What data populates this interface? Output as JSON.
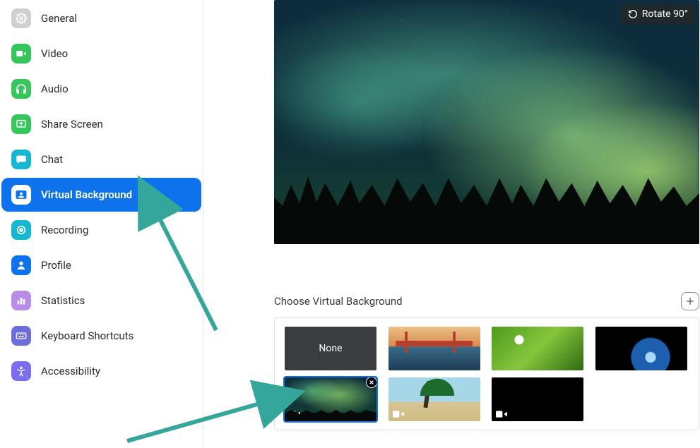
{
  "sidebar": {
    "items": [
      {
        "label": "General",
        "icon": "gear-icon",
        "color": "c-gray"
      },
      {
        "label": "Video",
        "icon": "video-icon",
        "color": "c-green"
      },
      {
        "label": "Audio",
        "icon": "headphones-icon",
        "color": "c-green"
      },
      {
        "label": "Share Screen",
        "icon": "share-screen-icon",
        "color": "c-green"
      },
      {
        "label": "Chat",
        "icon": "chat-icon",
        "color": "c-cyan"
      },
      {
        "label": "Virtual Background",
        "icon": "virtual-background-icon",
        "color": "c-blue",
        "active": true
      },
      {
        "label": "Recording",
        "icon": "recording-icon",
        "color": "c-cyan"
      },
      {
        "label": "Profile",
        "icon": "profile-icon",
        "color": "c-blue"
      },
      {
        "label": "Statistics",
        "icon": "statistics-icon",
        "color": "c-purple"
      },
      {
        "label": "Keyboard Shortcuts",
        "icon": "keyboard-icon",
        "color": "c-indigo"
      },
      {
        "label": "Accessibility",
        "icon": "accessibility-icon",
        "color": "c-violet"
      }
    ]
  },
  "preview": {
    "rotate_label": "Rotate 90°"
  },
  "virtual_background": {
    "section_title": "Choose Virtual Background",
    "thumbnails": {
      "none_label": "None"
    }
  }
}
